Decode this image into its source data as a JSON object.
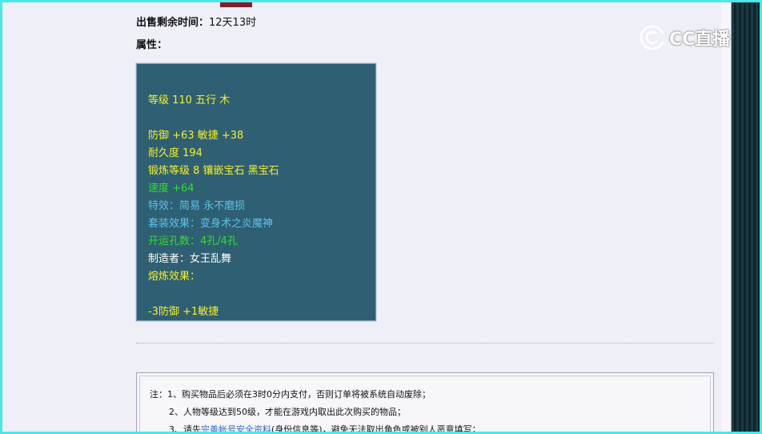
{
  "sale": {
    "time_label": "出售剩余时间：",
    "time_value": "12天13时",
    "attr_label": "属性："
  },
  "attributes": [
    {
      "text": "等级 110 五行 木",
      "color": "yellow"
    },
    {
      "text": "防御 +63 敏捷 +38",
      "color": "yellow"
    },
    {
      "text": "耐久度 194",
      "color": "yellow"
    },
    {
      "text": "锻炼等级 8 镶嵌宝石 黑宝石",
      "color": "yellow"
    },
    {
      "text": "速度 +64",
      "color": "green"
    },
    {
      "text": "特效：简易 永不磨损",
      "color": "blue"
    },
    {
      "text": "套装效果：变身术之炎魔神",
      "color": "blue"
    },
    {
      "text": "开运孔数：4孔/4孔",
      "color": "green"
    },
    {
      "text": "制造者：女王乱舞",
      "color": "white"
    },
    {
      "text": "熔炼效果：",
      "color": "yellow"
    },
    {
      "text": "-3防御 +1敏捷",
      "color": "yellow"
    }
  ],
  "notice": {
    "line1": "注：1、购买物品后必须在3时0分内支付，否则订单将被系统自动废除；",
    "line2": "2、人物等级达到50级，才能在游戏内取出此次购买的物品；",
    "line3_pre": "3、请先",
    "line3_link": "完善帐号安全资料",
    "line3_post": "(身份信息等)，避免无法取出角色或被别人恶意填写；"
  },
  "logo": {
    "text": "CC直播",
    "icon": "cc-live-logo-icon"
  },
  "colors": {
    "yellow": "#f2f22e",
    "green": "#2ee02e",
    "blue": "#5ec3e6",
    "white": "#ffffff",
    "panel": "#2f5f72",
    "frame": "#4ee6e6"
  }
}
